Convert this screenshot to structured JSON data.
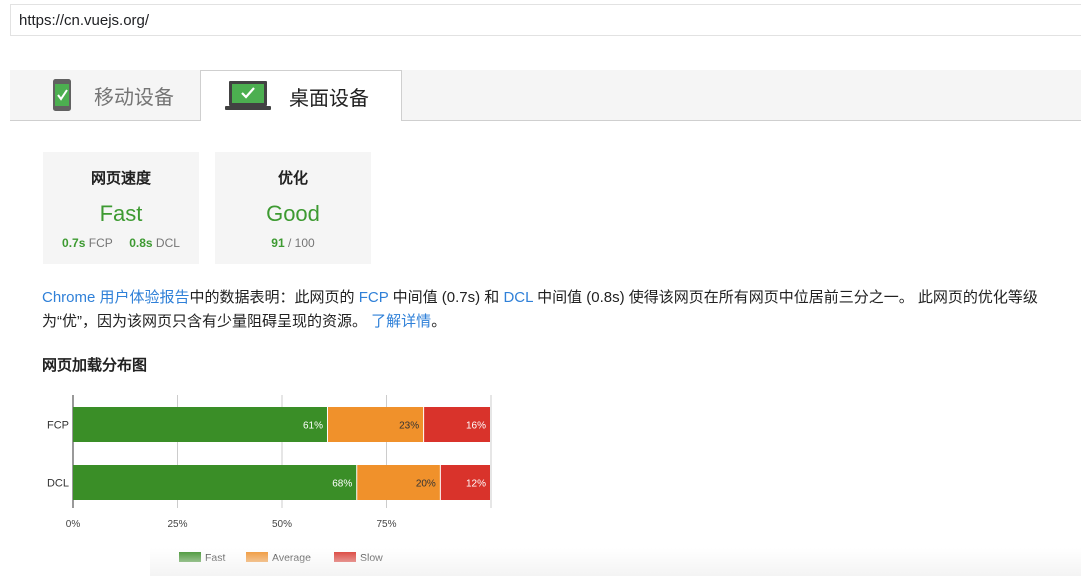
{
  "url_bar": {
    "url": "https://cn.vuejs.org/"
  },
  "tabs": [
    {
      "label": "移动设备",
      "icon": "mobile-check-icon",
      "selected": false
    },
    {
      "label": "桌面设备",
      "icon": "desktop-check-icon",
      "selected": true
    }
  ],
  "cards": {
    "speed": {
      "title": "网页速度",
      "value": "Fast",
      "fcp_value": "0.7s",
      "fcp_label": "FCP",
      "dcl_value": "0.8s",
      "dcl_label": "DCL"
    },
    "optimization": {
      "title": "优化",
      "value": "Good",
      "score": "91",
      "score_suffix": "/ 100"
    }
  },
  "summary": {
    "link_cux": "Chrome 用户体验报告",
    "text1": "中的数据表明：此网页的 ",
    "link_fcp": "FCP",
    "text2": " 中间值 (0.7s) 和 ",
    "link_dcl": "DCL",
    "text3": " 中间值 (0.8s) 使得该网页在所有网页中位居前三分之一。 此网页的优化等级为“优”，因为该网页只含有少量阻碍呈现的资源。 ",
    "link_learn": "了解详情",
    "text4": "。"
  },
  "distribution_title": "网页加载分布图",
  "colors": {
    "fast": "#3a8e27",
    "average": "#f0912b",
    "slow": "#d9332b",
    "accent_green": "#3d9a31",
    "link": "#2f80d8"
  },
  "chart_data": {
    "type": "bar",
    "orientation": "horizontal",
    "stacked": true,
    "categories": [
      "FCP",
      "DCL"
    ],
    "series": [
      {
        "name": "Fast",
        "values": [
          61,
          68
        ],
        "labels": [
          "61%",
          "68%"
        ]
      },
      {
        "name": "Average",
        "values": [
          23,
          20
        ],
        "labels": [
          "23%",
          "20%"
        ]
      },
      {
        "name": "Slow",
        "values": [
          16,
          12
        ],
        "labels": [
          "16%",
          "12%"
        ]
      }
    ],
    "xlim": [
      0,
      100
    ],
    "x_ticks": [
      "0%",
      "25%",
      "50%",
      "75%"
    ],
    "grid": true,
    "legend_position": "bottom"
  }
}
